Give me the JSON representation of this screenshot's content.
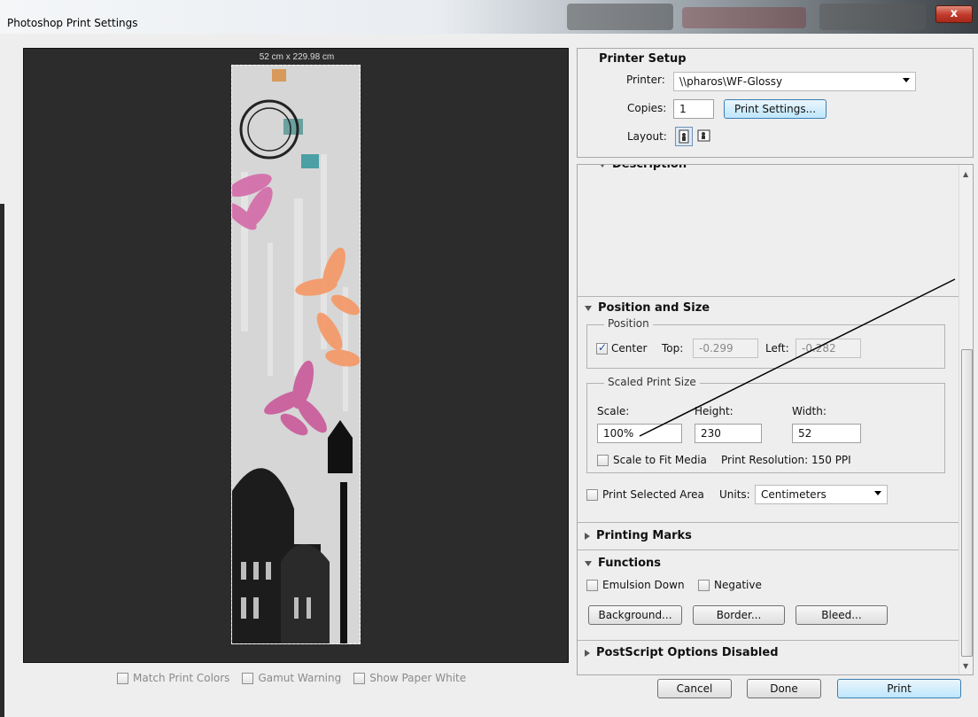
{
  "window": {
    "title": "Photoshop Print Settings",
    "close_glyph": "x"
  },
  "preview": {
    "dimension_label": "52 cm x 229.98 cm",
    "bottom_options": [
      {
        "label": "Match Print Colors",
        "checked": false
      },
      {
        "label": "Gamut Warning",
        "checked": false
      },
      {
        "label": "Show Paper White",
        "checked": false
      }
    ]
  },
  "printer_setup": {
    "title": "Printer Setup",
    "printer_label": "Printer:",
    "printer_value": "\\\\pharos\\WF-Glossy",
    "copies_label": "Copies:",
    "copies_value": "1",
    "print_settings_button": "Print Settings...",
    "layout_label": "Layout:",
    "layout_icons": [
      "portrait-layout-icon",
      "landscape-layout-icon"
    ]
  },
  "description": {
    "title": "Description"
  },
  "position_size": {
    "title": "Position and Size",
    "position_legend": "Position",
    "center_label": "Center",
    "center_checked": true,
    "top_label": "Top:",
    "top_value": "-0.299",
    "left_label": "Left:",
    "left_value": "-0.282",
    "scaled_legend": "Scaled Print Size",
    "scale_label": "Scale:",
    "height_label": "Height:",
    "width_label": "Width:",
    "scale_value": "100%",
    "height_value": "230",
    "width_value": "52",
    "fit_media_label": "Scale to Fit Media",
    "fit_media_checked": false,
    "resolution_text": "Print Resolution: 150 PPI",
    "print_selected_label": "Print Selected Area",
    "print_selected_checked": false,
    "units_label": "Units:",
    "units_value": "Centimeters"
  },
  "printing_marks": {
    "title": "Printing Marks"
  },
  "functions": {
    "title": "Functions",
    "emulsion_label": "Emulsion Down",
    "negative_label": "Negative",
    "background_button": "Background...",
    "border_button": "Border...",
    "bleed_button": "Bleed..."
  },
  "postscript": {
    "title": "PostScript Options Disabled"
  },
  "footer": {
    "cancel_button": "Cancel",
    "done_button": "Done",
    "print_button": "Print"
  },
  "colors": {
    "accent_checkbox": "#2a4a9a",
    "primary_button": "#bee6fd",
    "preview_bg": "#2c2c2c"
  }
}
